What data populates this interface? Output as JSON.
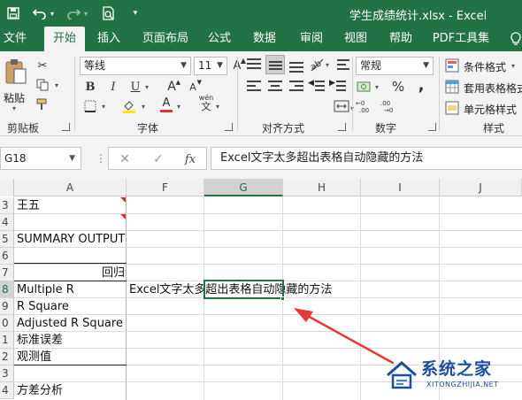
{
  "window": {
    "title": "学生成绩统计.xlsx  -  Excel",
    "quick_access": [
      "save-icon",
      "undo-icon",
      "redo-icon",
      "print-preview-icon",
      "customize-icon"
    ]
  },
  "tabs": [
    {
      "label": "文件",
      "active": false
    },
    {
      "label": "开始",
      "active": true
    },
    {
      "label": "插入",
      "active": false
    },
    {
      "label": "页面布局",
      "active": false
    },
    {
      "label": "公式",
      "active": false
    },
    {
      "label": "数据",
      "active": false
    },
    {
      "label": "审阅",
      "active": false
    },
    {
      "label": "视图",
      "active": false
    },
    {
      "label": "帮助",
      "active": false
    },
    {
      "label": "PDF工具集",
      "active": false
    }
  ],
  "ribbon": {
    "clipboard": {
      "paste_label": "粘贴",
      "group_label": "剪贴板"
    },
    "font": {
      "font_name": "等线",
      "font_size": "11",
      "bold": "B",
      "italic": "I",
      "underline": "U",
      "grow_font": "A",
      "shrink_font": "A",
      "font_color_glyph": "A",
      "phonetic": "wén",
      "group_label": "字体"
    },
    "alignment": {
      "group_label": "对齐方式"
    },
    "number": {
      "format": "常规",
      "percent": "%",
      "comma": ",",
      "group_label": "数字"
    },
    "styles": {
      "conditional": "条件格式",
      "table": "套用表格格式",
      "cell": "单元格样式",
      "group_label": "样式"
    },
    "colors": {
      "font_color": "#e03030",
      "fill_color": "#ffe600"
    }
  },
  "formula_bar": {
    "name_box": "G18",
    "cancel": "✕",
    "enter": "✓",
    "fx": "fx",
    "formula": "Excel文字太多超出表格自动隐藏的方法"
  },
  "sheet": {
    "columns": [
      "A",
      "F",
      "G",
      "H",
      "I",
      "J"
    ],
    "selected_column": "G",
    "rows": [
      "3",
      "4",
      "5",
      "6",
      "7",
      "8",
      "9",
      "0",
      "1",
      "2",
      "3",
      "4"
    ],
    "selected_row": "8",
    "cells": {
      "a3": "王五",
      "a5": "SUMMARY OUTPUT",
      "a7": "回归统",
      "a8": "Multiple R",
      "a9": "R Square",
      "a10": "Adjusted R Square",
      "a11": "标准误差",
      "a12": "观测值",
      "a14": "方差分析",
      "f8": "Excel文字太多超出表格自动隐藏的方法"
    }
  },
  "annotation": {
    "arrow_color": "#e53935"
  },
  "watermark": {
    "title": "系统之家",
    "subtitle": "XITONGZHIJIA.NET",
    "color": "#1a4f9c"
  }
}
